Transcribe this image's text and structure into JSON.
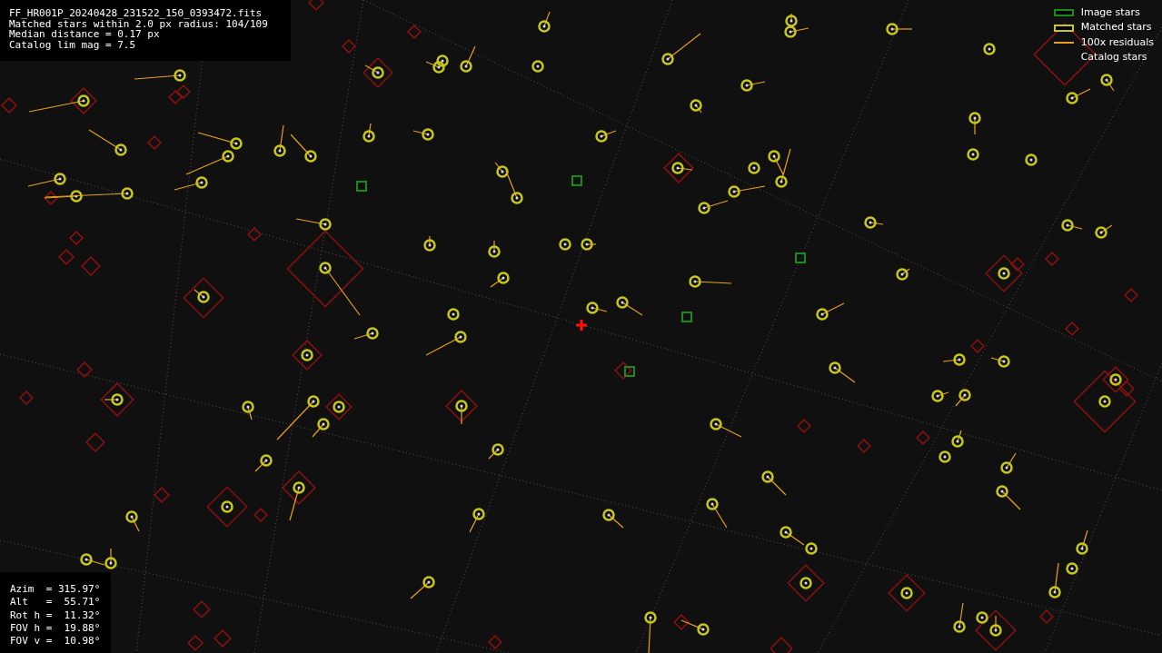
{
  "header": {
    "lines": [
      "FF_HR001P_20240428_231522_150_0393472.fits",
      "Matched stars within 2.0 px radius: 104/109",
      "Median distance = 0.17 px",
      "Catalog lim mag = 7.5"
    ]
  },
  "legend": [
    {
      "kind": "box",
      "label": "Image stars",
      "color": "#1a8a1a"
    },
    {
      "kind": "box",
      "label": "Matched stars",
      "color": "#c8c81a"
    },
    {
      "kind": "line",
      "label": "100x residuals",
      "color": "#e8a020"
    },
    {
      "kind": "none",
      "label": "Catalog stars"
    }
  ],
  "pointing": {
    "lines": [
      "Azim  = 315.97°",
      "Alt   =  55.71°",
      "Rot h =  11.32°",
      "FOV h =  19.88°",
      "FOV v =  10.98°"
    ]
  }
}
